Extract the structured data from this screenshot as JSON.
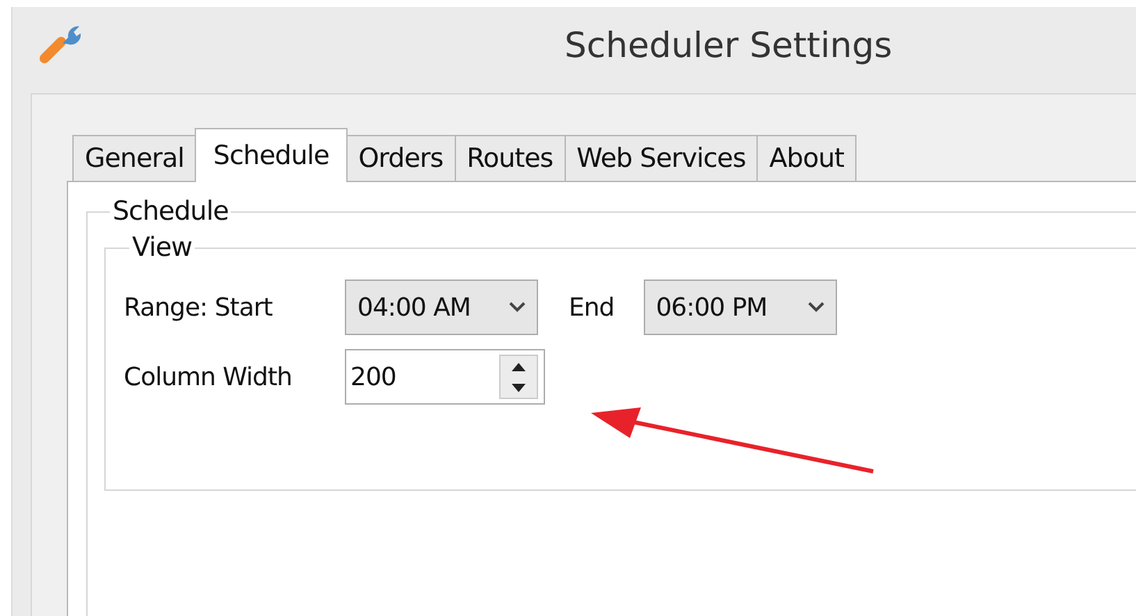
{
  "window": {
    "title": "Scheduler Settings"
  },
  "tabs": [
    {
      "label": "General",
      "selected": false
    },
    {
      "label": "Schedule",
      "selected": true
    },
    {
      "label": "Orders",
      "selected": false
    },
    {
      "label": "Routes",
      "selected": false
    },
    {
      "label": "Web Services",
      "selected": false
    },
    {
      "label": "About",
      "selected": false
    }
  ],
  "group": {
    "legend": "Schedule",
    "subgroup": {
      "legend": "View",
      "range": {
        "start_label": "Range: Start",
        "start_value": "04:00 AM",
        "end_label": "End",
        "end_value": "06:00 PM"
      },
      "column_width": {
        "label": "Column Width",
        "value": "200"
      }
    }
  },
  "annotation": {
    "kind": "arrow"
  }
}
